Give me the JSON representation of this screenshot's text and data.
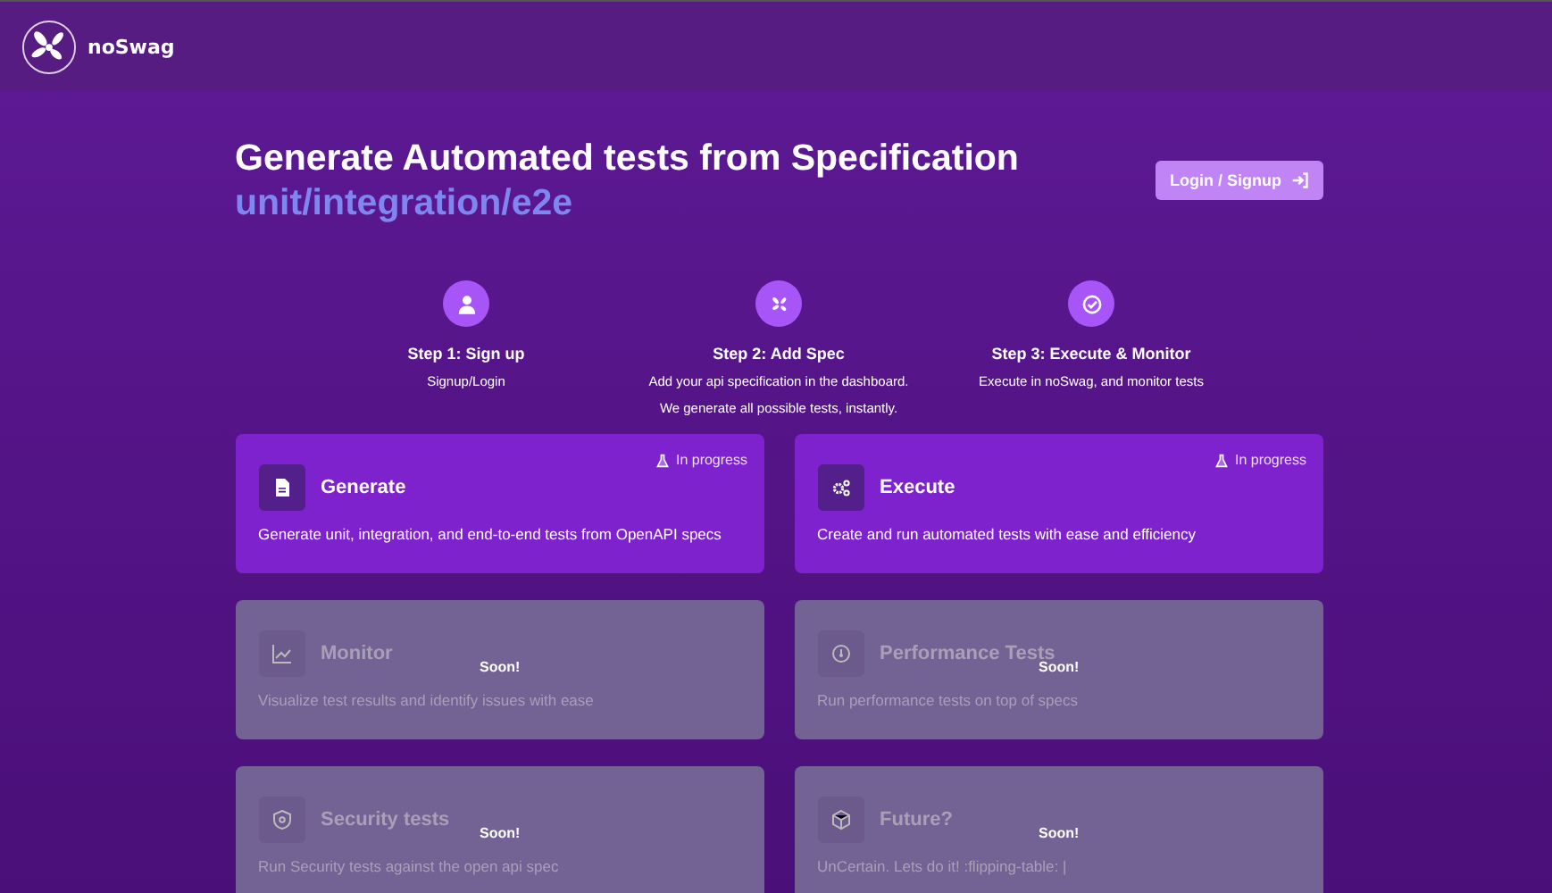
{
  "header": {
    "brand": "noSwag"
  },
  "hero": {
    "title": "Generate Automated tests from Specification",
    "subtitle": "unit/integration/e2e",
    "login_button": "Login / Signup"
  },
  "steps": [
    {
      "title": "Step 1: Sign up",
      "lines": [
        "Signup/Login"
      ]
    },
    {
      "title": "Step 2: Add Spec",
      "lines": [
        "Add your api specification in the dashboard.",
        "We generate all possible tests, instantly."
      ]
    },
    {
      "title": "Step 3: Execute & Monitor",
      "lines": [
        "Execute in noSwag, and monitor tests"
      ]
    }
  ],
  "features": [
    {
      "kind": "active",
      "title": "Generate",
      "description": "Generate unit, integration, and end-to-end tests from OpenAPI specs",
      "badge": "In progress"
    },
    {
      "kind": "active",
      "title": "Execute",
      "description": "Create and run automated tests with ease and efficiency",
      "badge": "In progress"
    },
    {
      "kind": "soon",
      "title": "Monitor",
      "description": "Visualize test results and identify issues with ease",
      "badge": "Soon!"
    },
    {
      "kind": "soon",
      "title": "Performance Tests",
      "description": "Run performance tests on top of specs",
      "badge": "Soon!"
    },
    {
      "kind": "soon",
      "title": "Security tests",
      "description": "Run Security tests against the open api spec",
      "badge": "Soon!"
    },
    {
      "kind": "soon",
      "title": "Future?",
      "description": "UnCertain. Lets do it! :flipping-table: |",
      "badge": "Soon!"
    }
  ]
}
